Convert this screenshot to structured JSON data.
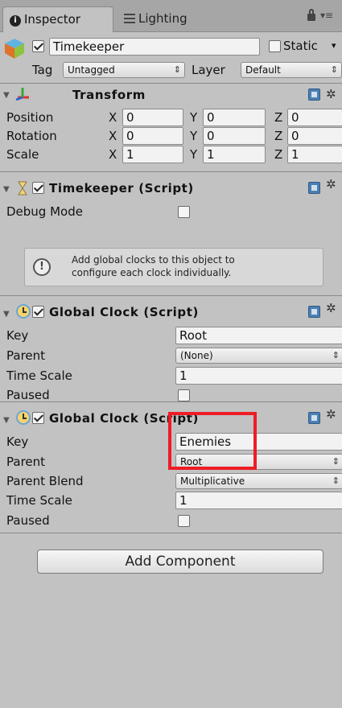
{
  "tabs": [
    {
      "label": "Inspector",
      "active": true
    },
    {
      "label": "Lighting",
      "active": false
    }
  ],
  "object": {
    "name": "Timekeeper",
    "active": true,
    "static_label": "Static",
    "tag_label": "Tag",
    "tag_value": "Untagged",
    "layer_label": "Layer",
    "layer_value": "Default"
  },
  "transform": {
    "title": "Transform",
    "rows": [
      {
        "label": "Position",
        "x": "0",
        "y": "0",
        "z": "0"
      },
      {
        "label": "Rotation",
        "x": "0",
        "y": "0",
        "z": "0"
      },
      {
        "label": "Scale",
        "x": "1",
        "y": "1",
        "z": "1"
      }
    ],
    "axis_x": "X",
    "axis_y": "Y",
    "axis_z": "Z"
  },
  "timekeeper": {
    "title": "Timekeeper (Script)",
    "debug_label": "Debug Mode",
    "debug_checked": false,
    "help_line1": "Add global clocks to this object to",
    "help_line2": "configure each clock individually."
  },
  "clock1": {
    "title": "Global Clock (Script)",
    "key_label": "Key",
    "key_value": "Root",
    "parent_label": "Parent",
    "parent_value": "(None)",
    "timescale_label": "Time Scale",
    "timescale_value": "1",
    "paused_label": "Paused"
  },
  "clock2": {
    "title": "Global Clock (Script)",
    "key_label": "Key",
    "key_value": "Enemies",
    "parent_label": "Parent",
    "parent_value": "Root",
    "blend_label": "Parent Blend",
    "blend_value": "Multiplicative",
    "timescale_label": "Time Scale",
    "timescale_value": "1",
    "paused_label": "Paused"
  },
  "add_component_label": "Add Component",
  "colors": {
    "background": "#c2c2c2",
    "highlight": "#ee1c25",
    "help_icon": "#4b7fb3"
  }
}
